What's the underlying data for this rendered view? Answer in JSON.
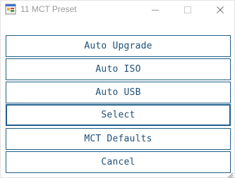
{
  "window": {
    "title": "11 MCT Preset",
    "icon": "app-window-icon",
    "controls": [
      "minimize-icon",
      "maximize-icon",
      "close-icon"
    ]
  },
  "buttons": [
    {
      "label": "Auto Upgrade"
    },
    {
      "label": "Auto ISO"
    },
    {
      "label": "Auto USB"
    },
    {
      "label": "Select",
      "focused": true
    },
    {
      "label": "MCT Defaults"
    },
    {
      "label": "Cancel"
    }
  ],
  "colors": {
    "button_border": "#1f5f8a",
    "button_text": "#1f4f76",
    "title_text": "#9a9a9a"
  }
}
